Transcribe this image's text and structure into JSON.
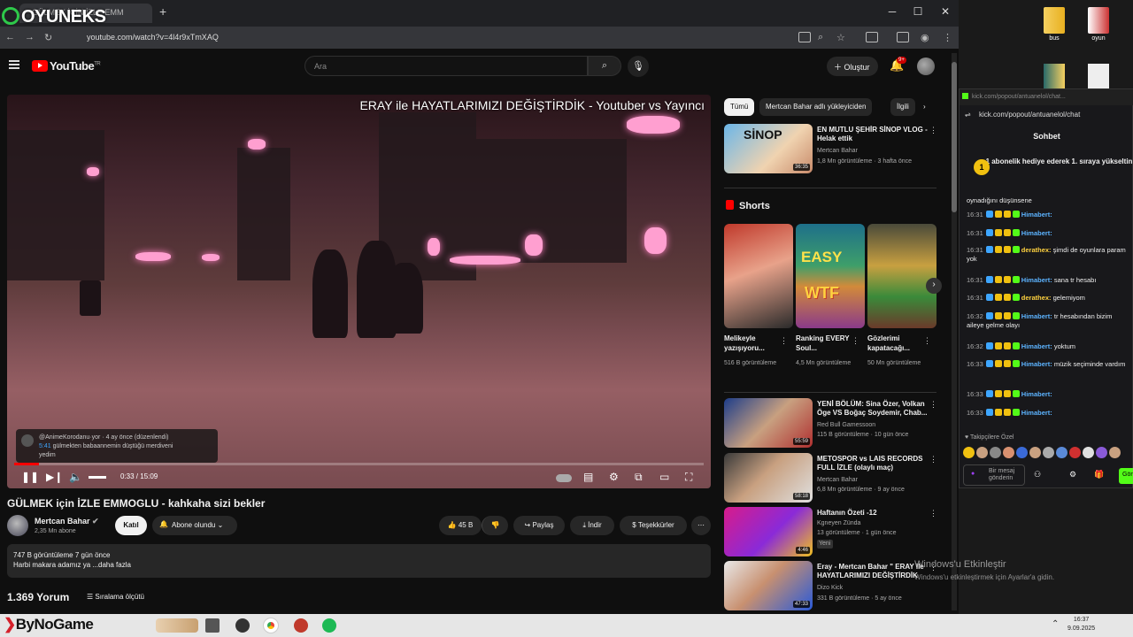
{
  "browser": {
    "tab_title": "GÜLMEK İÇİN İZLE EMM",
    "new_tab": "+",
    "url": "youtube.com/watch?v=4l4r9xTmXAQ",
    "win_min": "─",
    "win_max": "☐",
    "win_close": "✕"
  },
  "watermark": {
    "logo_text": "OYUNEKS"
  },
  "youtube": {
    "logo": "YouTube",
    "country": "TR",
    "search_placeholder": "Ara",
    "create_label": "Oluştur",
    "bell_badge": "9+"
  },
  "video": {
    "overlay_title": "ERAY ile HAYATLARIMIZI DEĞİŞTİRDİK - Youtuber vs Yayıncı",
    "comment_popup_user": "@AnimeKorodanu·yor · 4 ay önce (düzenlendi)",
    "comment_popup_time": "5:41",
    "comment_popup_text": "gülmekten babaannemin düştüğü merdiveni",
    "comment_popup_text2": "yedim",
    "time": "0:33 / 15:09",
    "progress": 0.036
  },
  "watch": {
    "title": "GÜLMEK için İZLE EMMOGLU - kahkaha sizi bekler",
    "channel": "Mertcan Bahar",
    "subs": "2,35 Mn abone",
    "join": "Katıl",
    "subscribe": "Abone olundu",
    "likes": "45 B",
    "share": "Paylaş",
    "download": "İndir",
    "thanks": "Teşekkürler",
    "more": "⋯",
    "desc_line1": "747 B görüntüleme  7 gün önce",
    "desc_line2": "Harbi makara adamız ya ...daha fazla",
    "comments": "1.369 Yorum",
    "sort": "Sıralama ölçütü"
  },
  "sidebar": {
    "chips": [
      "Tümü",
      "Mertcan Bahar adlı yükleyiciden",
      "İlgili"
    ],
    "videos": [
      {
        "title": "EN MUTLU ŞEHİR SİNOP VLOG - Helak ettik",
        "channel": "Mertcan Bahar",
        "meta": "1,8 Mn görüntüleme · 3 hafta önce",
        "dur": "36:35"
      },
      {
        "title": "YENİ BÖLÜM: Sina Özer, Volkan Öge VS Boğaç Soydemir, Chab...",
        "channel": "Red Bull Gamessoon",
        "meta": "115 B görüntüleme · 10 gün önce",
        "dur": "55:59"
      },
      {
        "title": "METOSPOR vs LAIS RECORDS FULL İZLE (olaylı maç)",
        "channel": "Mertcan Bahar",
        "meta": "6,8 Mn görüntüleme · 9 ay önce",
        "dur": "58:18"
      },
      {
        "title": "Haftanın Özeti -12",
        "channel": "Kgneyen Zünda",
        "meta": "13 görüntüleme · 1 gün önce",
        "badge": "Yeni",
        "dur": "4:46"
      },
      {
        "title": "Eray - Mertcan Bahar \" ERAY ile HAYATLARIMIZI DEĞİŞTİRDİK",
        "channel": "Dizo Kick",
        "meta": "331 B görüntüleme · 5 ay önce",
        "dur": "47:33"
      }
    ],
    "shorts_label": "Shorts",
    "shorts": [
      {
        "title": "Melikeyle yazışıyoru...",
        "views": "516 B görüntüleme"
      },
      {
        "title": "Ranking EVERY Soul...",
        "views": "4,5 Mn görüntüleme"
      },
      {
        "title": "Gözlerimi kapatacağı...",
        "views": "50 Mn görüntüleme"
      }
    ],
    "short_thumb_text": [
      "",
      "EASY",
      "WTF"
    ]
  },
  "windows": {
    "activate": "Windows'u Etkinleştir",
    "activate_sub": "Windows'u etkinleştirmek için Ayarlar'a gidin."
  },
  "desktop": {
    "icons": [
      "bus",
      "oyun"
    ]
  },
  "kick": {
    "top_bar": "kick.com/popout/antuanelol/chat...",
    "url": "kick.com/popout/antuanelol/chat",
    "header": "Sohbet",
    "gift_text": "1 abonelik hediye ederek 1. sıraya yükseltin",
    "gift_rank": "1",
    "pinned": "oynadığını düşünsene",
    "messages": [
      {
        "time": "16:31",
        "user": "Himabert:",
        "cls": "u1",
        "text": ""
      },
      {
        "time": "16:31",
        "user": "Himabert:",
        "cls": "u1",
        "text": ""
      },
      {
        "time": "16:31",
        "user": "derathex:",
        "cls": "u2",
        "text": "şimdi de oyunlara param yok"
      },
      {
        "time": "16:31",
        "user": "Himabert:",
        "cls": "u1",
        "text": "sana tr hesabı"
      },
      {
        "time": "16:31",
        "user": "derathex:",
        "cls": "u2",
        "text": "gelemiyom"
      },
      {
        "time": "16:32",
        "user": "Himabert:",
        "cls": "u1",
        "text": "tr hesabından bizim aileye gelme olayı"
      },
      {
        "time": "16:32",
        "user": "Himabert:",
        "cls": "u1",
        "text": "yoktum"
      },
      {
        "time": "16:33",
        "user": "Himabert:",
        "cls": "u1",
        "text": "müzik seçiminde vardım"
      },
      {
        "time": "16:33",
        "user": "Himabert:",
        "cls": "u1",
        "text": ""
      },
      {
        "time": "16:33",
        "user": "Himabert:",
        "cls": "u1",
        "text": ""
      }
    ],
    "follow_label": "Takipçilere Özel",
    "input_placeholder": "Bir mesaj gönderin",
    "send": "Gön"
  },
  "taskbar": {
    "brand": "ByNoGame",
    "time": "16:37",
    "date": "9.09.2025"
  }
}
